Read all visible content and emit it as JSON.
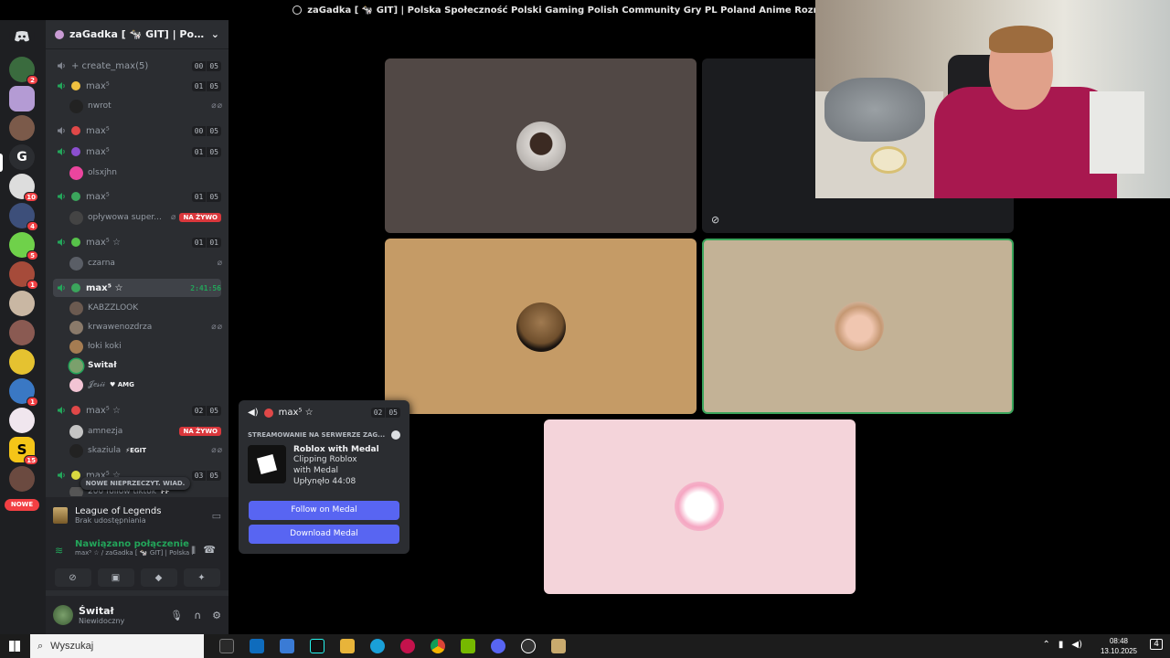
{
  "window": {
    "title": "zaGadka [ 🐄 GIT] | Polska Społeczność Polski Gaming Polish Community Gry PL Poland Anime Rozmowy Memy"
  },
  "server": {
    "name": "zaGadka [ 🐄 GIT] | Polska Społ..."
  },
  "rail": {
    "new_label": "NOWE",
    "badges": [
      "2",
      "10",
      "4",
      "5",
      "1",
      "1",
      "1",
      "15"
    ]
  },
  "channels": [
    {
      "label": "+ create_max(5)",
      "count": [
        "00",
        "05"
      ]
    },
    {
      "label": "max⁵",
      "count": [
        "01",
        "05"
      ],
      "users": [
        {
          "name": "nwrot"
        }
      ]
    },
    {
      "label": "max⁵",
      "count": [
        "00",
        "05"
      ]
    },
    {
      "label": "max⁵",
      "count": [
        "01",
        "05"
      ],
      "users": [
        {
          "name": "olsxjhn"
        }
      ]
    },
    {
      "label": "max⁵",
      "count": [
        "01",
        "05"
      ],
      "users": [
        {
          "name": "opływowa super...",
          "live": "NA ŻYWO"
        }
      ]
    },
    {
      "label": "max⁵ ☆",
      "count": [
        "01",
        "01"
      ],
      "users": [
        {
          "name": "czarna"
        }
      ]
    },
    {
      "label": "max⁵ ☆",
      "timer": "2:41:56",
      "users": [
        {
          "name": "KABZZLOOK"
        },
        {
          "name": "krwawenozdrza"
        },
        {
          "name": "łoki koki"
        },
        {
          "name": "Świtał"
        },
        {
          "name": "𝒥𝑒𝓈𝒾𝒾",
          "tag": "♥ AMG"
        }
      ]
    },
    {
      "label": "max⁵ ☆",
      "count": [
        "02",
        "05"
      ],
      "users": [
        {
          "name": "amnezja",
          "live": "NA ŻYWO"
        },
        {
          "name": "skaziula",
          "tag": "⚡EGIT"
        }
      ]
    },
    {
      "label": "max⁵ ☆",
      "count": [
        "03",
        "05"
      ],
      "users": [
        {
          "name": "200 follow tiktok",
          "tag": "FF"
        }
      ]
    }
  ],
  "new_messages": "NOWE NIEPRZECZYT. WIAD.",
  "activity": {
    "game": "League of Legends",
    "status": "Brak udostępniania"
  },
  "voice": {
    "status": "Nawiązano połączenie",
    "channel": "max⁵ ☆ / zaGadka [ 🐄 GIT] | Polska ..."
  },
  "user": {
    "name": "Świtał",
    "status": "Niewidoczny"
  },
  "popup": {
    "channel": "max⁵ ☆",
    "count": [
      "02",
      "05"
    ],
    "section": "STREAMOWANIE NA SERWERZE ZAG...",
    "game_title": "Roblox with Medal",
    "game_desc": [
      "Clipping Roblox",
      "with Medal",
      "Upłynęło 44:08"
    ],
    "follow_label": "Follow on Medal",
    "download_label": "Download Medal"
  },
  "taskbar": {
    "search_placeholder": "Wyszukaj",
    "time": "08:48",
    "date": "13.10.2025",
    "notif": "4"
  },
  "colors": {
    "accent": "#5865f2",
    "connected": "#23a55a",
    "live": "#da373c",
    "rail_bg": "#1e1f22",
    "panel_bg": "#2b2d31"
  }
}
